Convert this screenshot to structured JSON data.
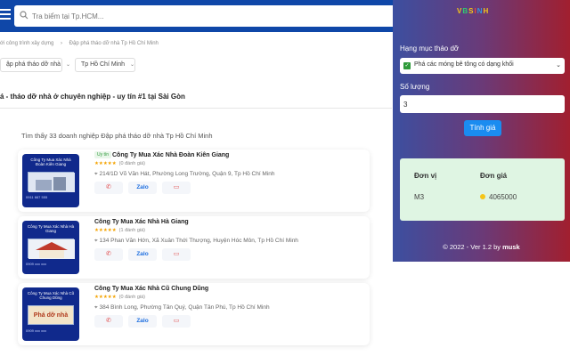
{
  "search": {
    "placeholder": "Tra biểm tại Tp.HCM..."
  },
  "breadcrumb": [
    "ới công trình xây dựng",
    "Đập phá tháo dỡ nhà Tp Hồ Chí Minh"
  ],
  "filters": [
    {
      "label": "ập phá tháo dỡ nhà"
    },
    {
      "label": "Tp Hồ Chí Minh"
    }
  ],
  "headline": "á - tháo dỡ nhà ở chuyên nghiệp - uy tín #1 tại Sài Gòn",
  "found_text": "Tìm thấy 33 doanh nghiệp Đập phá tháo dỡ nhà Tp Hồ Chí Minh",
  "listings": [
    {
      "thumb_title": "Công Ty Mua Xác Nhà Đoàn Kiên Giang",
      "thumb_footer": "0911 667 555",
      "verified": "Uy tín",
      "name": "Công Ty Mua Xác Nhà Đoàn Kiên Giang",
      "stars": "★★★★★",
      "reviews": "(0 đánh giá)",
      "address": "214/1D Võ Văn Hát, Phường Long Trường, Quận 9, Tp Hồ Chí Minh",
      "zalo": "Zalo"
    },
    {
      "thumb_title": "Công Ty Mua Xác Nhà Hà Giang",
      "thumb_footer": "0909 xxx xxx",
      "name": "Công Ty Mua Xác Nhà Hà Giang",
      "stars": "★★★★★",
      "reviews": "(1 đánh giá)",
      "address": "134 Phan Văn Hớn, Xã Xuân Thới Thượng, Huyện Hóc Môn, Tp Hồ Chí Minh",
      "zalo": "Zalo"
    },
    {
      "thumb_title": "Công Ty Mua Xác Nhà Cũ Chung Dũng",
      "thumb_img_text": "Phá dỡ nhà",
      "thumb_footer": "0909 xxx xxx",
      "name": "Công Ty Mua Xác Nhà Cũ Chung Dũng",
      "stars": "★★★★★",
      "reviews": "(0 đánh giá)",
      "address": "384 Bình Long, Phường Tân Quý, Quận Tân Phú, Tp Hồ Chí Minh",
      "zalo": "Zalo"
    }
  ],
  "panel": {
    "logo_letters": [
      {
        "ch": "V",
        "color": "#f5c518"
      },
      {
        "ch": "B",
        "color": "#2ecc71"
      },
      {
        "ch": "S",
        "color": "#f5c518"
      },
      {
        "ch": "I",
        "color": "#e74c3c"
      },
      {
        "ch": "N",
        "color": "#3498db"
      },
      {
        "ch": "H",
        "color": "#f5c518"
      }
    ],
    "category_label": "Hạng mục tháo dỡ",
    "category_value": "Phá các móng bê tông có dạng khối",
    "qty_label": "Số lượng",
    "qty_value": "3",
    "calc_button": "Tính giá",
    "unit_header": "Đơn vị",
    "price_header": "Đơn giá",
    "unit_value": "M3",
    "price_value": "4065000",
    "footer_text": "© 2022 - Ver 1.2 by",
    "footer_author": "musk"
  },
  "colors": {
    "topbar": "#0f47a8",
    "panel_gradient": [
      "#3c4fa0",
      "#a11f2f"
    ],
    "result_bg": "#dff5e3",
    "button": "#1a8cf0"
  }
}
